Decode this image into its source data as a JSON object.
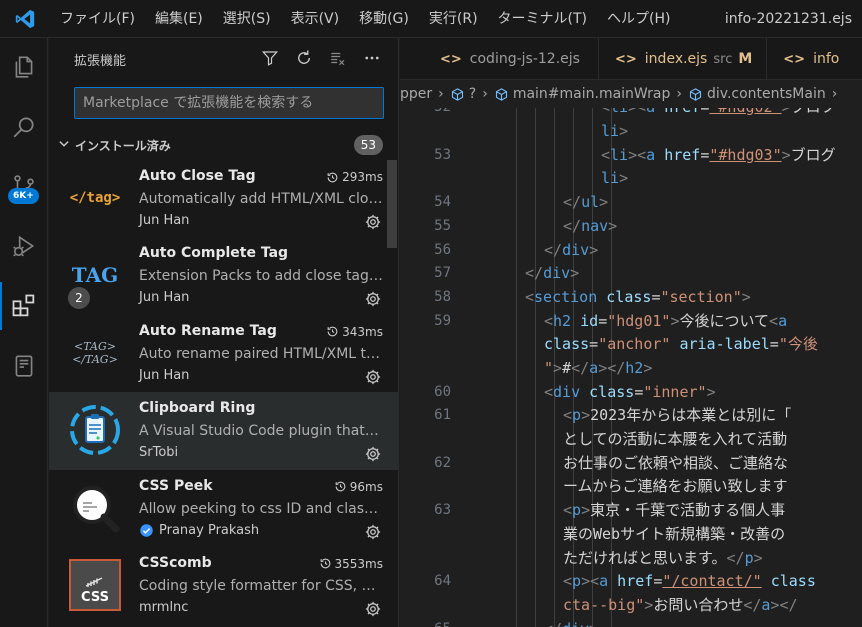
{
  "menu": [
    "ファイル(F)",
    "編集(E)",
    "選択(S)",
    "表示(V)",
    "移動(G)",
    "実行(R)",
    "ターミナル(T)",
    "ヘルプ(H)"
  ],
  "window_title": "info-20221231.ejs",
  "activity": {
    "source_control_badge": "6K+"
  },
  "sidebar": {
    "title": "拡張機能",
    "search_placeholder": "Marketplace で拡張機能を検索する",
    "section_title": "インストール済み",
    "section_count": "53",
    "extensions": [
      {
        "name": "Auto Close Tag",
        "desc": "Automatically add HTML/XML close tag, same as Visual Studio IDE or Sublime Text",
        "pub": "Jun Han",
        "time": "293ms"
      },
      {
        "name": "Auto Complete Tag",
        "desc": "Extension Packs to add close tag and rename paired tag",
        "pub": "Jun Han",
        "badge": "2"
      },
      {
        "name": "Auto Rename Tag",
        "desc": "Auto rename paired HTML/XML tag",
        "pub": "Jun Han",
        "time": "343ms"
      },
      {
        "name": "Clipboard Ring",
        "desc": "A Visual Studio Code plugin that maintains a clipboard ring",
        "pub": "SrTobi"
      },
      {
        "name": "CSS Peek",
        "desc": "Allow peeking to css ID and class strings as definitions from html files",
        "pub": "Pranay Prakash",
        "time": "96ms"
      },
      {
        "name": "CSScomb",
        "desc": "Coding style formatter for CSS, Less, SCSS and Sass",
        "pub": "mrmlnc",
        "time": "3553ms"
      }
    ],
    "icon_labels": {
      "auto_close": "</tag>",
      "auto_complete": "TAG",
      "auto_rename_top": "<TAG>",
      "auto_rename_bottom": "</TAG>",
      "csscomb": "CSS"
    }
  },
  "tabs": [
    {
      "label": "coding-js-12.ejs"
    },
    {
      "label": "index.ejs",
      "sub": "src",
      "mod": "M"
    },
    {
      "label": "info"
    }
  ],
  "breadcrumb": [
    "pper",
    "?",
    "main#main.mainWrap",
    "div.contentsMain"
  ],
  "code_lines": [
    {
      "n": "52",
      "parts": [
        [
          "t",
          "<"
        ],
        [
          "tag",
          "li"
        ],
        [
          "t",
          ">"
        ],
        [
          "t",
          "<"
        ],
        [
          "tag",
          "a"
        ],
        [
          "attr",
          " href"
        ],
        [
          "txt",
          "="
        ],
        [
          "str",
          "\"#hdg02\""
        ],
        [
          "t",
          ">"
        ],
        [
          "txt",
          "プロフ"
        ]
      ]
    },
    {
      "n": "",
      "parts": [
        [
          "tag",
          "li"
        ],
        [
          "t",
          ">"
        ]
      ]
    },
    {
      "n": "53",
      "parts": [
        [
          "t",
          "<"
        ],
        [
          "tag",
          "li"
        ],
        [
          "t",
          ">"
        ],
        [
          "t",
          "<"
        ],
        [
          "tag",
          "a"
        ],
        [
          "attr",
          " href"
        ],
        [
          "txt",
          "="
        ],
        [
          "str",
          "\"#hdg03\""
        ],
        [
          "t",
          ">"
        ],
        [
          "txt",
          "ブログ"
        ]
      ]
    },
    {
      "n": "",
      "parts": [
        [
          "tag",
          "li"
        ],
        [
          "t",
          ">"
        ]
      ]
    },
    {
      "n": "54",
      "parts": [
        [
          "t",
          "</"
        ],
        [
          "tag",
          "ul"
        ],
        [
          "t",
          ">"
        ]
      ]
    },
    {
      "n": "55",
      "parts": [
        [
          "t",
          "</"
        ],
        [
          "tag",
          "nav"
        ],
        [
          "t",
          ">"
        ]
      ]
    },
    {
      "n": "56",
      "parts": [
        [
          "t",
          "</"
        ],
        [
          "tag",
          "div"
        ],
        [
          "t",
          ">"
        ]
      ]
    },
    {
      "n": "57",
      "parts": [
        [
          "t",
          "</"
        ],
        [
          "tag",
          "div"
        ],
        [
          "t",
          ">"
        ]
      ]
    },
    {
      "n": "58",
      "parts": [
        [
          "t",
          "<"
        ],
        [
          "tag",
          "section"
        ],
        [
          "attr",
          " class"
        ],
        [
          "txt",
          "="
        ],
        [
          "str",
          "\"section\""
        ],
        [
          "t",
          ">"
        ]
      ]
    },
    {
      "n": "59",
      "parts": [
        [
          "t",
          "<"
        ],
        [
          "tag",
          "h2"
        ],
        [
          "attr",
          " id"
        ],
        [
          "txt",
          "="
        ],
        [
          "str",
          "\"hdg01\""
        ],
        [
          "t",
          ">"
        ],
        [
          "txt",
          "今後について"
        ],
        [
          "t",
          "<"
        ],
        [
          "tag",
          "a"
        ]
      ]
    },
    {
      "n": "",
      "parts": [
        [
          "attr",
          "class"
        ],
        [
          "txt",
          "="
        ],
        [
          "str",
          "\"anchor\""
        ],
        [
          "attr",
          " aria-label"
        ],
        [
          "txt",
          "="
        ],
        [
          "str",
          "\"今後"
        ]
      ]
    },
    {
      "n": "",
      "parts": [
        [
          "str",
          "\""
        ],
        [
          "t",
          ">"
        ],
        [
          "txt",
          "#"
        ],
        [
          "t",
          "</"
        ],
        [
          "tag",
          "a"
        ],
        [
          "t",
          ">"
        ],
        [
          "t",
          "</"
        ],
        [
          "tag",
          "h2"
        ],
        [
          "t",
          ">"
        ]
      ]
    },
    {
      "n": "60",
      "parts": [
        [
          "t",
          "<"
        ],
        [
          "tag",
          "div"
        ],
        [
          "attr",
          " class"
        ],
        [
          "txt",
          "="
        ],
        [
          "str",
          "\"inner\""
        ],
        [
          "t",
          ">"
        ]
      ]
    },
    {
      "n": "61",
      "parts": [
        [
          "t",
          "<"
        ],
        [
          "tag",
          "p"
        ],
        [
          "t",
          ">"
        ],
        [
          "txt",
          "2023年からは本業とは別に「"
        ]
      ]
    },
    {
      "n": "",
      "parts": [
        [
          "txt",
          "としての活動に本腰を入れて活動"
        ]
      ]
    },
    {
      "n": "62",
      "parts": [
        [
          "txt",
          "お仕事のご依頼や相談、ご連絡な"
        ]
      ]
    },
    {
      "n": "",
      "parts": [
        [
          "txt",
          "ームからご連絡をお願い致します"
        ]
      ]
    },
    {
      "n": "63",
      "parts": [
        [
          "t",
          "<"
        ],
        [
          "tag",
          "p"
        ],
        [
          "t",
          ">"
        ],
        [
          "txt",
          "東京・千葉で活動する個人事"
        ]
      ]
    },
    {
      "n": "",
      "parts": [
        [
          "txt",
          "業のWebサイト新規構築・改善の"
        ]
      ]
    },
    {
      "n": "",
      "parts": [
        [
          "txt",
          "ただければと思います。"
        ],
        [
          "t",
          "</"
        ],
        [
          "tag",
          "p"
        ],
        [
          "t",
          ">"
        ]
      ]
    },
    {
      "n": "64",
      "parts": [
        [
          "t",
          "<"
        ],
        [
          "tag",
          "p"
        ],
        [
          "t",
          ">"
        ],
        [
          "t",
          "<"
        ],
        [
          "tag",
          "a"
        ],
        [
          "attr",
          " href"
        ],
        [
          "txt",
          "="
        ],
        [
          "str",
          "\"/contact/\""
        ],
        [
          "attr",
          " class"
        ]
      ]
    },
    {
      "n": "",
      "parts": [
        [
          "str",
          "cta--big\""
        ],
        [
          "t",
          ">"
        ],
        [
          "txt",
          "お問い合わせ"
        ],
        [
          "t",
          "</"
        ],
        [
          "tag",
          "a"
        ],
        [
          "t",
          ">"
        ],
        [
          "t",
          "</"
        ]
      ]
    },
    {
      "n": "65",
      "parts": [
        [
          "t",
          "</"
        ],
        [
          "tag",
          "div"
        ],
        [
          "t",
          ">"
        ]
      ]
    }
  ]
}
